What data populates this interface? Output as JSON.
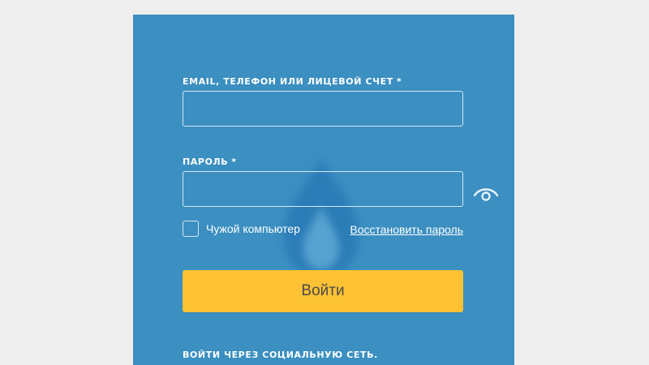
{
  "form": {
    "login_label": "EMAIL, ТЕЛЕФОН ИЛИ ЛИЦЕВОЙ СЧЕТ",
    "login_required_mark": "*",
    "login_value": "",
    "password_label": "ПАРОЛЬ",
    "password_required_mark": "*",
    "password_value": "",
    "show_password_icon": "eye-icon",
    "remember_label": "Чужой компьютер",
    "remember_checked": false,
    "restore_link": "Восстановить пароль",
    "submit_label": "Войти",
    "social_label": "ВОЙТИ ЧЕРЕЗ СОЦИАЛЬНУЮ СЕТЬ."
  },
  "colors": {
    "background": "#efefef",
    "panel": "#3b8fc1",
    "submit_button": "#fcc234",
    "text": "#ffffff"
  },
  "icons": {
    "watermark": "gas-flame-icon"
  }
}
